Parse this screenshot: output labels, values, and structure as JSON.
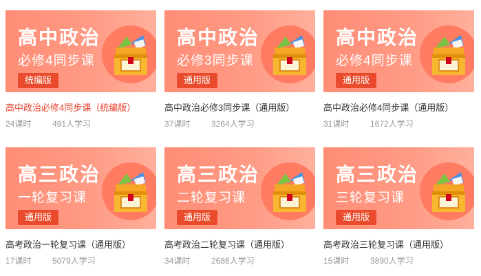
{
  "courses": [
    {
      "thumb_title": "高中政治",
      "thumb_sub": "必修4同步课",
      "badge": "统编版",
      "title": "高中政治必修4同步课（统编版）",
      "lessons": "24课时",
      "learners": "491人学习"
    },
    {
      "thumb_title": "高中政治",
      "thumb_sub": "必修3同步课",
      "badge": "通用版",
      "title": "高中政治必修3同步课（通用版）",
      "lessons": "37课时",
      "learners": "3264人学习"
    },
    {
      "thumb_title": "高中政治",
      "thumb_sub": "必修4同步课",
      "badge": "通用版",
      "title": "高中政治必修4同步课（通用版）",
      "lessons": "31课时",
      "learners": "1672人学习"
    },
    {
      "thumb_title": "高三政治",
      "thumb_sub": "一轮复习课",
      "badge": "通用版",
      "title": "高考政治一轮复习课（通用版）",
      "lessons": "17课时",
      "learners": "5079人学习"
    },
    {
      "thumb_title": "高三政治",
      "thumb_sub": "二轮复习课",
      "badge": "通用版",
      "title": "高考政治二轮复习课（通用版）",
      "lessons": "34课时",
      "learners": "2686人学习"
    },
    {
      "thumb_title": "高三政治",
      "thumb_sub": "三轮复习课",
      "badge": "通用版",
      "title": "高考政治三轮复习课（通用版）",
      "lessons": "15课时",
      "learners": "3890人学习"
    }
  ],
  "colors": {
    "thumb_bg": "#ff9a84",
    "badge_bg": "#e94b2c",
    "active_title": "#e8402a",
    "meta_text": "#999999"
  },
  "icons": {
    "thumbnail": "treasure-box-icon"
  }
}
